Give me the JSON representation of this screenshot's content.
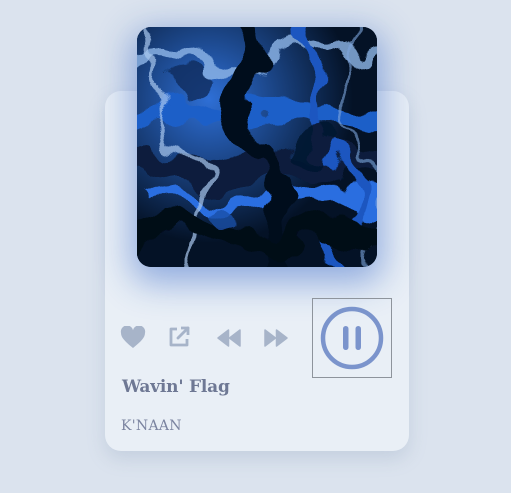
{
  "track": {
    "title": "Wavin' Flag",
    "artist": "K'NAAN"
  },
  "playback": {
    "state": "playing"
  },
  "icons": {
    "like": "heart-icon",
    "share": "external-link-icon",
    "rewind": "rewind-icon",
    "fast_forward": "fast-forward-icon",
    "toggle": "pause-icon"
  },
  "colors": {
    "background": "#dbe3ee",
    "card": "#e9eff6",
    "control_icon": "#a7b4c9",
    "pause_ring": "#7b94cc",
    "title_text": "#6e7894",
    "artist_text": "#7b84a0"
  }
}
